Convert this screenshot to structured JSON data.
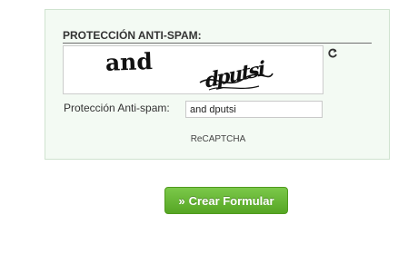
{
  "captcha_panel": {
    "title": "PROTECCIÓN ANTI-SPAM:",
    "captcha_image_words": [
      "and",
      "dputsi"
    ],
    "reload_icon": "reload-icon",
    "field_label": "Protección Anti-spam:",
    "field_value": "and dputsi",
    "provider_label": "ReCAPTCHA"
  },
  "submit": {
    "arrow": "»",
    "label": "Crear Formular"
  },
  "colors": {
    "panel_background": "#f3faf3",
    "panel_border": "#cfe3cf",
    "button_green": "#5fb02d"
  }
}
